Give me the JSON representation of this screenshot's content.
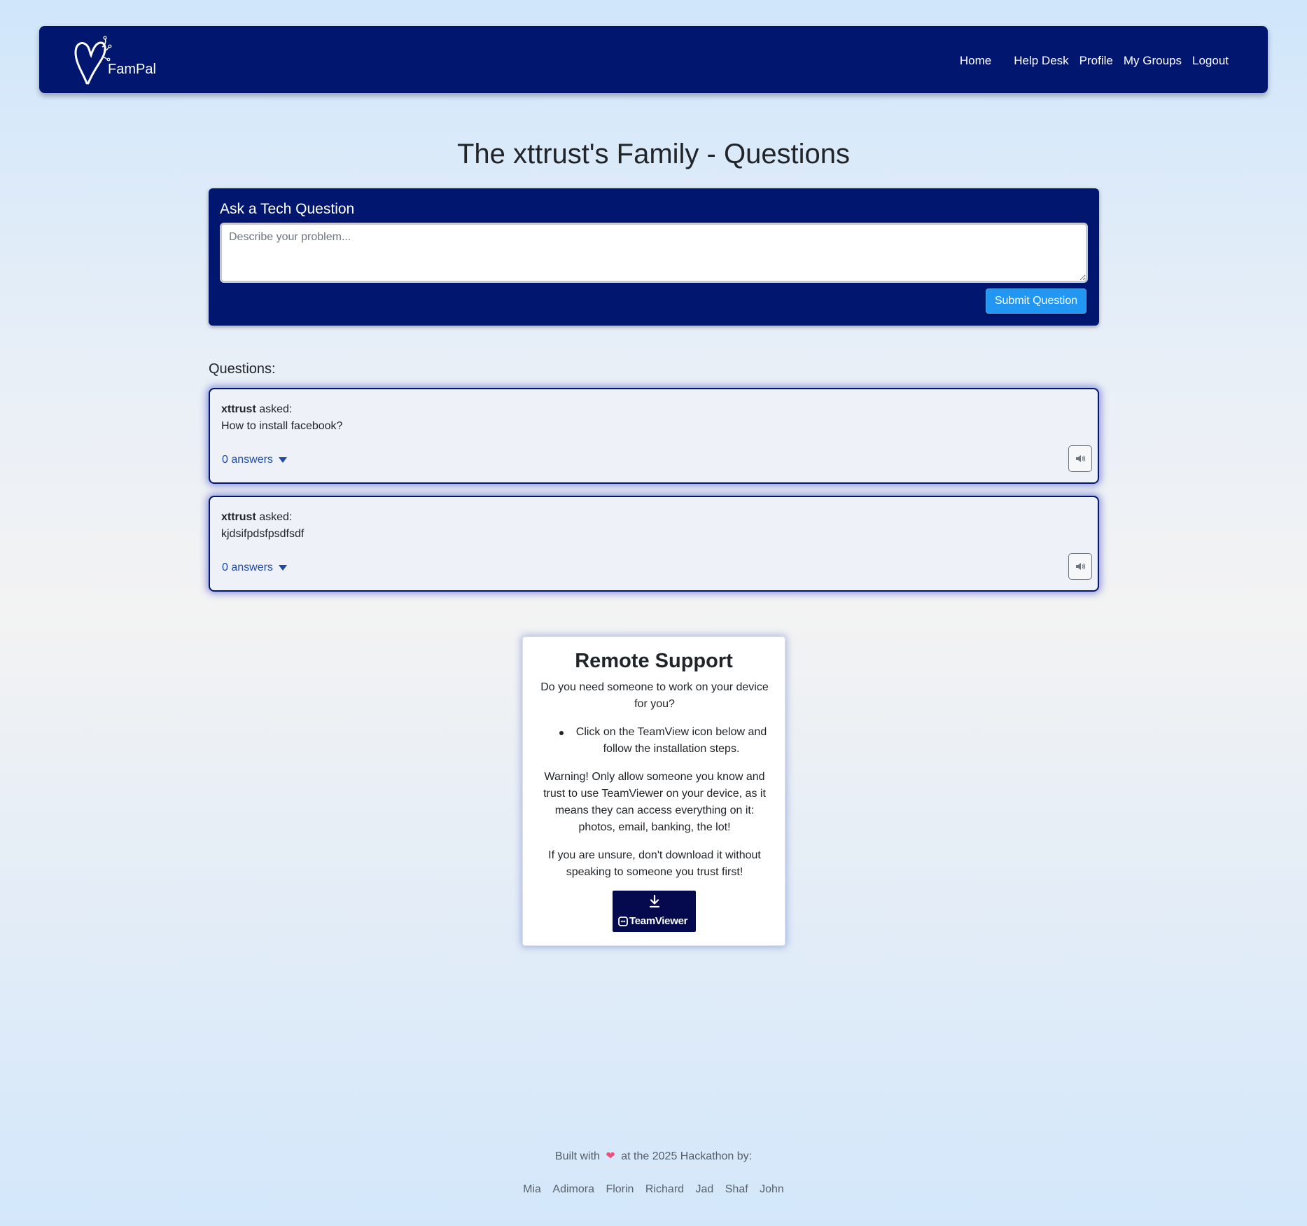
{
  "app": {
    "brand_name": "FamPal"
  },
  "nav": {
    "items": [
      {
        "label": "Home"
      },
      {
        "label": "Help Desk"
      },
      {
        "label": "Profile"
      },
      {
        "label": "My Groups"
      },
      {
        "label": "Logout"
      }
    ]
  },
  "page": {
    "title": "The xttrust's Family - Questions"
  },
  "ask": {
    "title": "Ask a Tech Question",
    "placeholder": "Describe your problem...",
    "submit_label": "Submit Question"
  },
  "questions": {
    "label": "Questions:",
    "items": [
      {
        "author": "xttrust",
        "asked": "asked:",
        "text": "How to install facebook?",
        "answers": "0 answers"
      },
      {
        "author": "xttrust",
        "asked": "asked:",
        "text": "kjdsifpdsfpsdfsdf",
        "answers": "0 answers"
      }
    ]
  },
  "remote": {
    "title": "Remote Support",
    "intro": "Do you need someone to work on your device for you?",
    "bullet": "Click on the TeamView icon below and follow the installation steps.",
    "warning": "Warning! Only allow someone you know and trust to use TeamViewer on your device, as it means they can access everything on it: photos, email, banking, the lot!",
    "unsure": "If you are unsure, don't download it without speaking to someone you trust first!",
    "button_label": "TeamViewer"
  },
  "footer": {
    "built_before": "Built with",
    "built_after": "at the 2025 Hackathon by:",
    "names": [
      "Mia",
      "Adimora",
      "Florin",
      "Richard",
      "Jad",
      "Shaf",
      "John"
    ]
  },
  "colors": {
    "navbar": "#01166f",
    "submit": "#2196f3",
    "link": "#1f4aa8",
    "heart": "#e8547f",
    "teamviewer_bg": "#050a4f"
  },
  "icons": {
    "logo": "heart-logo-icon",
    "caret": "caret-down-icon",
    "speaker": "speaker-icon",
    "download": "download-icon",
    "teamviewer": "teamviewer-icon",
    "heart": "heart-icon"
  }
}
